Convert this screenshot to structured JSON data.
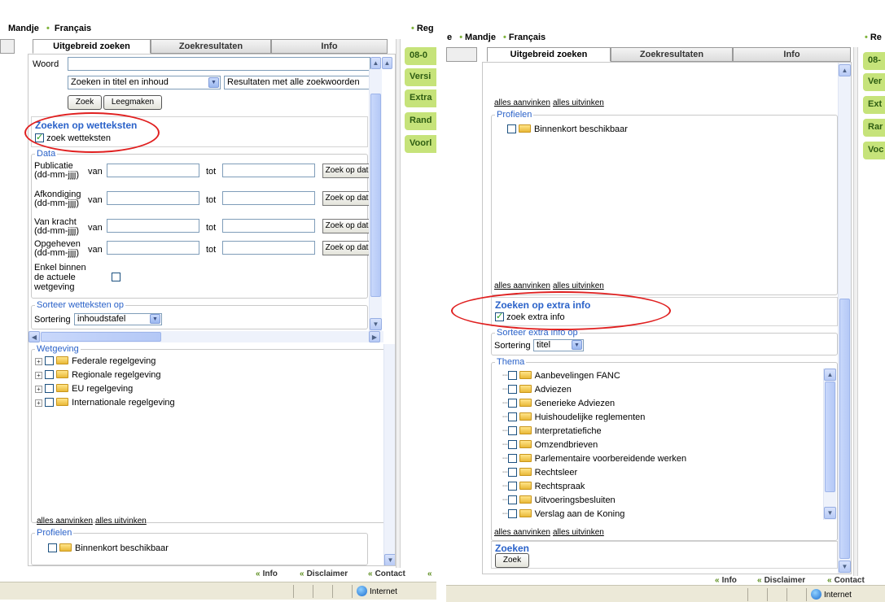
{
  "left": {
    "nav": {
      "item1": "Mandje",
      "item2": "Français",
      "right_item": "Reg"
    },
    "tabs": [
      "Uitgebreid zoeken",
      "Zoekresultaten",
      "Info"
    ],
    "search": {
      "woord_label": "Woord",
      "woord_value": "",
      "scope_select": "Zoeken in titel en inhoud",
      "mode_select": "Resultaten met alle zoekwoorden",
      "zoek_button": "Zoek",
      "clear_button": "Leegmaken"
    },
    "wetteksten": {
      "title": "Zoeken op wetteksten",
      "checkbox_label": "zoek wetteksten"
    },
    "data": {
      "legend": "Data",
      "van": "van",
      "tot": "tot",
      "rows": [
        {
          "label1": "Publicatie",
          "label2": "(dd-mm-jjjj)",
          "button": "Zoek op dat"
        },
        {
          "label1": "Afkondiging",
          "label2": "(dd-mm-jjjj)",
          "button": "Zoek op dat"
        },
        {
          "label1": "Van kracht",
          "label2": "(dd-mm-jjjj)",
          "button": "Zoek op dat"
        },
        {
          "label1": "Opgeheven",
          "label2": "(dd-mm-jjjj)",
          "button": "Zoek op dat"
        }
      ],
      "enkel1": "Enkel binnen",
      "enkel2": "de actuele",
      "enkel3": "wetgeving"
    },
    "sort": {
      "legend": "Sorteer wetteksten op",
      "label": "Sortering",
      "value": "inhoudstafel"
    },
    "wetgeving": {
      "legend": "Wetgeving",
      "items": [
        "Federale regelgeving",
        "Regionale regelgeving",
        "EU regelgeving",
        "Internationale regelgeving"
      ]
    },
    "links": {
      "check_all": "alles aanvinken",
      "uncheck_all": "alles uitvinken"
    },
    "profielen": {
      "legend": "Profielen",
      "item": "Binnenkort beschikbaar"
    },
    "green_tabs": [
      "08-0",
      "Versi",
      "Extra",
      "Rand",
      "Voorl"
    ],
    "footer": {
      "info": "Info",
      "disclaimer": "Disclaimer",
      "contact": "Contact"
    },
    "status": {
      "zone": "Internet"
    }
  },
  "right": {
    "nav": {
      "item0": "e",
      "item1": "Mandje",
      "item2": "Français",
      "right_item": "Re"
    },
    "tabs": [
      "Uitgebreid zoeken",
      "Zoekresultaten",
      "Info"
    ],
    "links_top": {
      "check_all": "alles aanvinken",
      "uncheck_all": "alles uitvinken"
    },
    "profielen": {
      "legend": "Profielen",
      "item": "Binnenkort beschikbaar"
    },
    "links_mid": {
      "check_all": "alles aanvinken",
      "uncheck_all": "alles uitvinken"
    },
    "extra": {
      "title": "Zoeken op extra info",
      "checkbox_label": "zoek extra info"
    },
    "sort": {
      "legend": "Sorteer extra info op",
      "label": "Sortering",
      "value": "titel"
    },
    "thema": {
      "legend": "Thema",
      "items": [
        "Aanbevelingen FANC",
        "Adviezen",
        "Generieke Adviezen",
        "Huishoudelijke reglementen",
        "Interpretatiefiche",
        "Omzendbrieven",
        "Parlementaire voorbereidende werken",
        "Rechtsleer",
        "Rechtspraak",
        "Uitvoeringsbesluiten",
        "Verslag aan de Koning"
      ]
    },
    "links_bottom": {
      "check_all": "alles aanvinken",
      "uncheck_all": "alles uitvinken"
    },
    "zoeken": {
      "title": "Zoeken",
      "button": "Zoek"
    },
    "green_tabs": [
      "08-",
      "Ver",
      "Ext",
      "Rar",
      "Voc"
    ],
    "footer": {
      "info": "Info",
      "disclaimer": "Disclaimer",
      "contact": "Contact"
    },
    "status": {
      "zone": "Internet"
    }
  },
  "colors": {
    "accent_blue": "#2a62c9",
    "green_tab": "#c6e37a",
    "highlight_circle": "#e02020"
  }
}
